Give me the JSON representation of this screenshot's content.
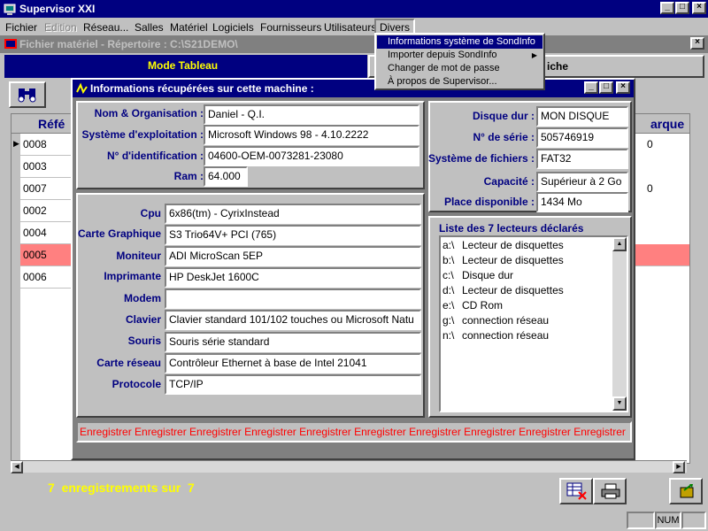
{
  "window": {
    "title": "Supervisor XXI"
  },
  "menubar": [
    {
      "label": "Fichier",
      "disabled": false
    },
    {
      "label": "Edition",
      "disabled": true
    },
    {
      "label": "Réseau...",
      "disabled": false
    },
    {
      "label": "Salles",
      "disabled": false
    },
    {
      "label": "Matériel",
      "disabled": false
    },
    {
      "label": "Logiciels",
      "disabled": false
    },
    {
      "label": "Fournisseurs",
      "disabled": false
    },
    {
      "label": "Utilisateurs",
      "disabled": false
    },
    {
      "label": "Divers",
      "disabled": false
    }
  ],
  "divers_menu": [
    "Informations système de SondInfo",
    "Importer depuis SondInfo",
    "Changer de mot de passe",
    "À propos de Supervisor..."
  ],
  "child_window": {
    "title": "Fichier matériel - Répertoire : C:\\S21DEMO\\"
  },
  "tabs": {
    "mode_tableau": "Mode Tableau",
    "fiche": "iche"
  },
  "table": {
    "header_left": "Réfé",
    "header_right": "arque",
    "rows": [
      "0008",
      "0003",
      "0007",
      "0002",
      "0004",
      "0005",
      "0006"
    ],
    "right_values": [
      "0",
      "0"
    ]
  },
  "status": {
    "records": "7  enregistrements sur  7",
    "num": "NUM"
  },
  "dialog": {
    "title": "Informations récupérées sur cette machine :",
    "identity": {
      "nom_label": "Nom & Organisation :",
      "nom": "Daniel - Q.I.",
      "os_label": "Système d'exploitation :",
      "os": "Microsoft Windows 98 - 4.10.2222",
      "id_label": "N° d'identification :",
      "id": "04600-OEM-0073281-23080",
      "ram_label": "Ram :",
      "ram": "64.000"
    },
    "disk": {
      "disque_label": "Disque dur :",
      "disque": "MON DISQUE",
      "serie_label": "N° de série :",
      "serie": "505746919",
      "fs_label": "Système de fichiers :",
      "fs": "FAT32",
      "capacite_label": "Capacité :",
      "capacite": "Supérieur à 2 Go",
      "place_label": "Place disponible :",
      "place": "1434 Mo"
    },
    "hardware": [
      {
        "label": "Cpu",
        "value": "6x86(tm) - CyrixInstead"
      },
      {
        "label": "Carte Graphique",
        "value": "S3 Trio64V+ PCI (765)"
      },
      {
        "label": "Moniteur",
        "value": "ADI MicroScan 5EP"
      },
      {
        "label": "Imprimante",
        "value": "HP DeskJet 1600C"
      },
      {
        "label": "Modem",
        "value": ""
      },
      {
        "label": "Clavier",
        "value": "Clavier standard 101/102 touches ou Microsoft Natu"
      },
      {
        "label": "Souris",
        "value": "Souris série standard"
      },
      {
        "label": "Carte réseau",
        "value": "Contrôleur Ethernet à base de Intel 21041"
      },
      {
        "label": "Protocole",
        "value": "TCP/IP"
      }
    ],
    "drives_title": "Liste des 7 lecteurs déclarés",
    "drives": [
      {
        "letter": "a:\\",
        "type": "Lecteur de disquettes"
      },
      {
        "letter": "b:\\",
        "type": "Lecteur de disquettes"
      },
      {
        "letter": "c:\\",
        "type": "Disque dur"
      },
      {
        "letter": "d:\\",
        "type": "Lecteur de disquettes"
      },
      {
        "letter": "e:\\",
        "type": "CD Rom"
      },
      {
        "letter": "g:\\",
        "type": "connection réseau"
      },
      {
        "letter": "n:\\",
        "type": "connection réseau"
      }
    ],
    "save_marquee": "Enregistrer Enregistrer Enregistrer Enregistrer Enregistrer Enregistrer Enregistrer Enregistrer Enregistrer Enregistrer"
  },
  "colors": {
    "titlebar": "#000080",
    "accent_yellow": "#ffff00",
    "selected_row": "#ff8080",
    "marquee_red": "#ff0000"
  }
}
